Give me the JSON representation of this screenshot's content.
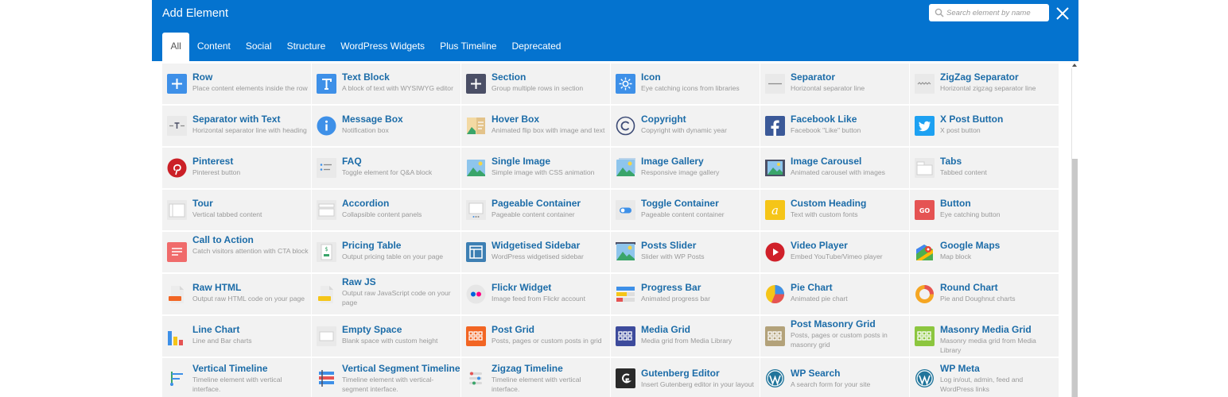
{
  "dialog": {
    "title": "Add Element"
  },
  "search": {
    "placeholder": "Search element by name",
    "value": ""
  },
  "tabs": [
    {
      "label": "All",
      "active": true
    },
    {
      "label": "Content",
      "active": false
    },
    {
      "label": "Social",
      "active": false
    },
    {
      "label": "Structure",
      "active": false
    },
    {
      "label": "WordPress Widgets",
      "active": false
    },
    {
      "label": "Plus Timeline",
      "active": false
    },
    {
      "label": "Deprecated",
      "active": false
    }
  ],
  "elements": [
    {
      "name": "Row",
      "desc": "Place content elements inside the row",
      "icon": "row-icon"
    },
    {
      "name": "Text Block",
      "desc": "A block of text with WYSIWYG editor",
      "icon": "text-block-icon"
    },
    {
      "name": "Section",
      "desc": "Group multiple rows in section",
      "icon": "section-icon"
    },
    {
      "name": "Icon",
      "desc": "Eye catching icons from libraries",
      "icon": "icon-icon"
    },
    {
      "name": "Separator",
      "desc": "Horizontal separator line",
      "icon": "separator-icon"
    },
    {
      "name": "ZigZag Separator",
      "desc": "Horizontal zigzag separator line",
      "icon": "zigzag-separator-icon"
    },
    {
      "name": "Separator with Text",
      "desc": "Horizontal separator line with heading",
      "icon": "separator-with-text-icon"
    },
    {
      "name": "Message Box",
      "desc": "Notification box",
      "icon": "message-box-icon"
    },
    {
      "name": "Hover Box",
      "desc": "Animated flip box with image and text",
      "icon": "hover-box-icon"
    },
    {
      "name": "Copyright",
      "desc": "Copyright with dynamic year",
      "icon": "copyright-icon"
    },
    {
      "name": "Facebook Like",
      "desc": "Facebook \"Like\" button",
      "icon": "facebook-icon"
    },
    {
      "name": "X Post Button",
      "desc": "X post button",
      "icon": "twitter-icon"
    },
    {
      "name": "Pinterest",
      "desc": "Pinterest button",
      "icon": "pinterest-icon"
    },
    {
      "name": "FAQ",
      "desc": "Toggle element for Q&A block",
      "icon": "faq-icon"
    },
    {
      "name": "Single Image",
      "desc": "Simple image with CSS animation",
      "icon": "single-image-icon"
    },
    {
      "name": "Image Gallery",
      "desc": "Responsive image gallery",
      "icon": "image-gallery-icon"
    },
    {
      "name": "Image Carousel",
      "desc": "Animated carousel with images",
      "icon": "image-carousel-icon"
    },
    {
      "name": "Tabs",
      "desc": "Tabbed content",
      "icon": "tabs-icon"
    },
    {
      "name": "Tour",
      "desc": "Vertical tabbed content",
      "icon": "tour-icon"
    },
    {
      "name": "Accordion",
      "desc": "Collapsible content panels",
      "icon": "accordion-icon"
    },
    {
      "name": "Pageable Container",
      "desc": "Pageable content container",
      "icon": "pageable-container-icon"
    },
    {
      "name": "Toggle Container",
      "desc": "Pageable content container",
      "icon": "toggle-container-icon"
    },
    {
      "name": "Custom Heading",
      "desc": "Text with custom fonts",
      "icon": "custom-heading-icon"
    },
    {
      "name": "Button",
      "desc": "Eye catching button",
      "icon": "button-icon"
    },
    {
      "name": "Call to Action",
      "desc": "Catch visitors attention with CTA block",
      "icon": "call-to-action-icon"
    },
    {
      "name": "Pricing Table",
      "desc": "Output pricing table on your page",
      "icon": "pricing-table-icon"
    },
    {
      "name": "Widgetised Sidebar",
      "desc": "WordPress widgetised sidebar",
      "icon": "widgetised-sidebar-icon"
    },
    {
      "name": "Posts Slider",
      "desc": "Slider with WP Posts",
      "icon": "posts-slider-icon"
    },
    {
      "name": "Video Player",
      "desc": "Embed YouTube/Vimeo player",
      "icon": "video-player-icon"
    },
    {
      "name": "Google Maps",
      "desc": "Map block",
      "icon": "google-maps-icon"
    },
    {
      "name": "Raw HTML",
      "desc": "Output raw HTML code on your page",
      "icon": "raw-html-icon"
    },
    {
      "name": "Raw JS",
      "desc": "Output raw JavaScript code on your page",
      "icon": "raw-js-icon"
    },
    {
      "name": "Flickr Widget",
      "desc": "Image feed from Flickr account",
      "icon": "flickr-icon"
    },
    {
      "name": "Progress Bar",
      "desc": "Animated progress bar",
      "icon": "progress-bar-icon"
    },
    {
      "name": "Pie Chart",
      "desc": "Animated pie chart",
      "icon": "pie-chart-icon"
    },
    {
      "name": "Round Chart",
      "desc": "Pie and Doughnut charts",
      "icon": "round-chart-icon"
    },
    {
      "name": "Line Chart",
      "desc": "Line and Bar charts",
      "icon": "line-chart-icon"
    },
    {
      "name": "Empty Space",
      "desc": "Blank space with custom height",
      "icon": "empty-space-icon"
    },
    {
      "name": "Post Grid",
      "desc": "Posts, pages or custom posts in grid",
      "icon": "post-grid-icon"
    },
    {
      "name": "Media Grid",
      "desc": "Media grid from Media Library",
      "icon": "media-grid-icon"
    },
    {
      "name": "Post Masonry Grid",
      "desc": "Posts, pages or custom posts in masonry grid",
      "icon": "post-masonry-grid-icon"
    },
    {
      "name": "Masonry Media Grid",
      "desc": "Masonry media grid from Media Library",
      "icon": "masonry-media-grid-icon"
    },
    {
      "name": "Vertical Timeline",
      "desc": "Timeline element with vertical interface.",
      "icon": "vertical-timeline-icon"
    },
    {
      "name": "Vertical Segment Timeline",
      "desc": "Timeline element with vertical-segment interface.",
      "icon": "vertical-segment-timeline-icon"
    },
    {
      "name": "Zigzag Timeline",
      "desc": "Timeline element with vertical interface.",
      "icon": "zigzag-timeline-icon"
    },
    {
      "name": "Gutenberg Editor",
      "desc": "Insert Gutenberg editor in your layout",
      "icon": "gutenberg-icon"
    },
    {
      "name": "WP Search",
      "desc": "A search form for your site",
      "icon": "wordpress-icon"
    },
    {
      "name": "WP Meta",
      "desc": "Log in/out, admin, feed and WordPress links",
      "icon": "wordpress-icon"
    }
  ]
}
